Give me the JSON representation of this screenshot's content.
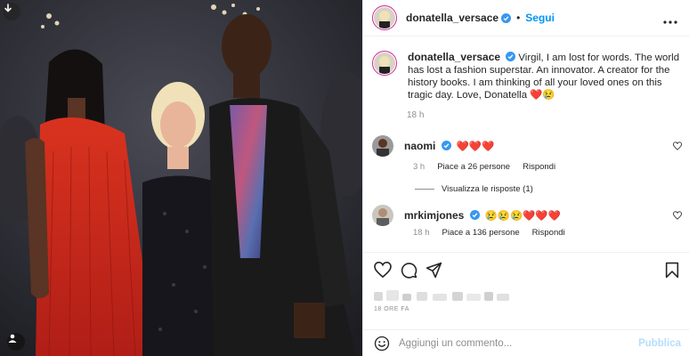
{
  "post": {
    "author": "donatella_versace",
    "follow_label": "Segui",
    "caption": "Virgil, I am lost for words. The world has lost a fashion superstar. An innovator. A creator for the history books. I am thinking of all your loved ones on this tragic day. Love, Donatella",
    "caption_emojis": "❤️😢",
    "caption_time": "18 h"
  },
  "comments": [
    {
      "user": "naomi",
      "text": "❤️❤️❤️",
      "time": "3 h",
      "likes": "Piace a 26 persone",
      "reply": "Rispondi",
      "view_replies": "Visualizza le risposte (1)"
    },
    {
      "user": "mrkimjones",
      "text": "😢😢😢❤️❤️❤️",
      "time": "18 h",
      "likes": "Piace a 136 persone",
      "reply": "Rispondi"
    }
  ],
  "footer": {
    "time_ago": "18 ORE FA",
    "comment_placeholder": "Aggiungi un commento...",
    "publish_label": "Pubblica"
  },
  "colors": {
    "link_blue": "#0095f6",
    "publish_disabled": "#b2dffc",
    "heart_red": "#e0245e",
    "story_ring": "#d6249f"
  },
  "icons": {
    "download": "download-icon",
    "more": "more-options-icon",
    "like": "heart-icon",
    "comment": "comment-icon",
    "share": "share-icon",
    "save": "bookmark-icon",
    "emoji": "emoji-icon",
    "tags": "user-tag-icon"
  }
}
